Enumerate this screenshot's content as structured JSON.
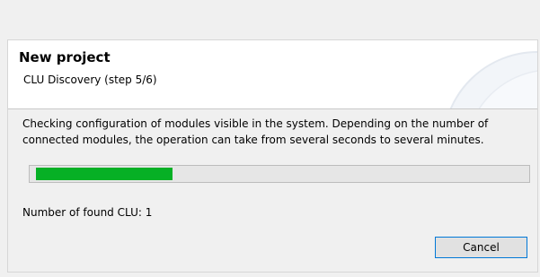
{
  "dialog": {
    "title": "New project",
    "subtitle": "CLU Discovery (step 5/6)",
    "message": "Checking configuration of modules visible in the system. Depending on the number of connected modules, the operation can take from several seconds to several minutes.",
    "found_label": "Number of found CLU: 1",
    "cancel_label": "Cancel"
  },
  "progress": {
    "value_fraction": 0.28,
    "color": "#06b025"
  },
  "colors": {
    "accent_border": "#0078d7",
    "background": "#f0f0f0"
  }
}
